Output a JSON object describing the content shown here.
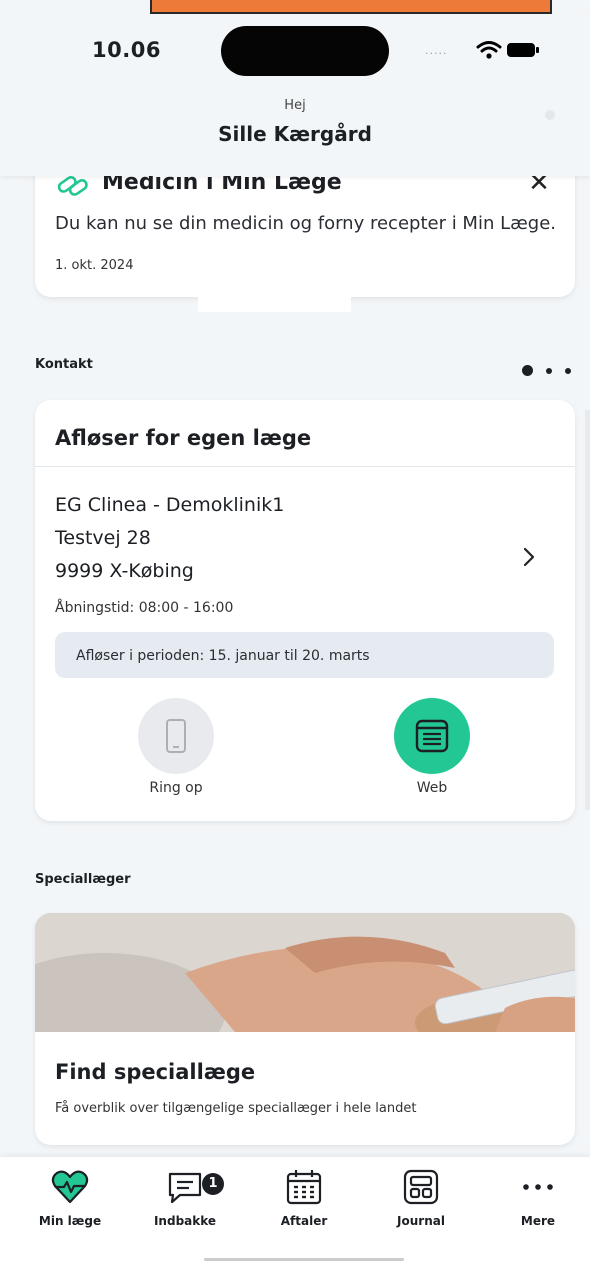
{
  "status_bar": {
    "time": "10.06",
    "dots": "....."
  },
  "header": {
    "greeting": "Hej",
    "user_name": "Sille Kærgård"
  },
  "notice": {
    "title": "Medicin i Min Læge",
    "body": "Du kan nu se din medicin og forny recepter i Min Læge.",
    "date": "1. okt. 2024",
    "close_glyph": "✕"
  },
  "contact": {
    "section_label": "Kontakt",
    "pager": {
      "pages": 3,
      "current": 1
    },
    "card_title": "Afløser for egen læge",
    "clinic_name": "EG Clinea - Demoklinik1",
    "street": "Testvej 28",
    "city": "9999 X-Købing",
    "chevron": "›",
    "hours": "Åbningstid: 08:00 - 16:00",
    "period": "Afløser i perioden: 15. januar til 20. marts",
    "actions": [
      {
        "label": "Ring op",
        "icon": "phone-icon",
        "enabled": false
      },
      {
        "label": "Web",
        "icon": "web-icon",
        "enabled": true
      }
    ]
  },
  "specialists": {
    "section_label": "Speciallæger",
    "title": "Find speciallæge",
    "subtitle": "Få overblik over tilgængelige speciallæger i hele landet"
  },
  "bottom_nav": {
    "items": [
      {
        "label": "Min læge",
        "icon": "heart-pulse-icon"
      },
      {
        "label": "Indbakke",
        "icon": "chat-bubble-icon"
      },
      {
        "label": "Aftaler",
        "icon": "calendar-icon"
      },
      {
        "label": "Journal",
        "icon": "journal-icon"
      },
      {
        "label": "Mere",
        "icon": "more-icon"
      }
    ],
    "inbox_badge": "1"
  },
  "colors": {
    "accent": "#23c793",
    "header_bg": "#f3f6f8",
    "top_band": "#ee7a3a"
  }
}
